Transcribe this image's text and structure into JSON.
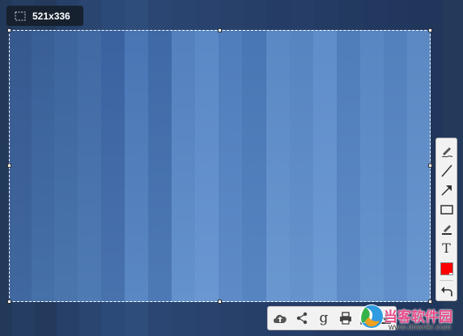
{
  "selection": {
    "size_label": "521x336"
  },
  "toolbar": {
    "tools": [
      {
        "name": "pen-icon",
        "label": "Pen"
      },
      {
        "name": "line-icon",
        "label": "Line"
      },
      {
        "name": "arrow-icon",
        "label": "Arrow"
      },
      {
        "name": "rectangle-icon",
        "label": "Rectangle"
      },
      {
        "name": "marker-icon",
        "label": "Marker"
      },
      {
        "name": "text-icon",
        "label": "T"
      },
      {
        "name": "color-swatch",
        "label": "Color",
        "color": "#ff0000"
      },
      {
        "name": "undo-icon",
        "label": "Undo"
      }
    ],
    "text_tool_glyph": "T"
  },
  "actions": {
    "items": [
      {
        "name": "upload-cloud-icon"
      },
      {
        "name": "share-icon"
      },
      {
        "name": "google-search-icon",
        "glyph": "g"
      },
      {
        "name": "print-icon"
      },
      {
        "name": "copy-icon"
      },
      {
        "name": "save-icon"
      }
    ],
    "google_glyph": "g"
  },
  "watermark": {
    "main": "当客软件园",
    "sub": "www.downkr.com"
  },
  "colors": {
    "accent_swatch": "#ff0000",
    "badge_bg": "#141c28"
  }
}
